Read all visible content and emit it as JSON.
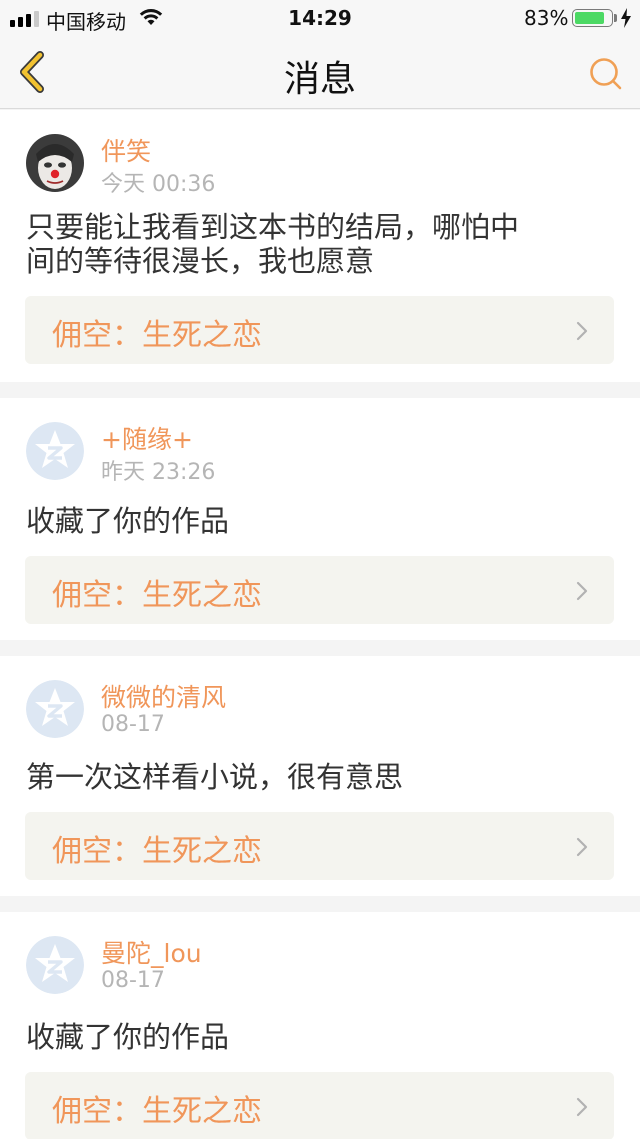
{
  "status_bar": {
    "carrier": "中国移动",
    "time": "14:29",
    "battery_percent": "83%",
    "battery_level": 0.83,
    "battery_color": "#4cd964"
  },
  "nav": {
    "title": "消息",
    "back_icon": "chevron-left-icon",
    "search_icon": "search-icon"
  },
  "colors": {
    "accent": "#f0965a",
    "nav_back": "#f2c230",
    "search": "#f0a055",
    "link_bg": "#f4f4ef"
  },
  "messages": [
    {
      "username": "伴笑",
      "time": "今天 00:36",
      "content_lines": [
        "只要能让我看到这本书的结局，哪怕中",
        "间的等待很漫长，我也愿意"
      ],
      "work_title": "佣空：生死之恋",
      "avatar": "photo-avatar"
    },
    {
      "username": "+随缘+",
      "time": "昨天 23:26",
      "content_lines": [
        "收藏了你的作品"
      ],
      "work_title": "佣空：生死之恋",
      "avatar": "default-qq-avatar"
    },
    {
      "username": "微微的清风",
      "time": "08-17",
      "content_lines": [
        "第一次这样看小说，很有意思"
      ],
      "work_title": "佣空：生死之恋",
      "avatar": "default-qq-avatar"
    },
    {
      "username": "曼陀_lou",
      "time": "08-17",
      "content_lines": [
        "收藏了你的作品"
      ],
      "work_title": "佣空：生死之恋",
      "avatar": "default-qq-avatar"
    }
  ]
}
